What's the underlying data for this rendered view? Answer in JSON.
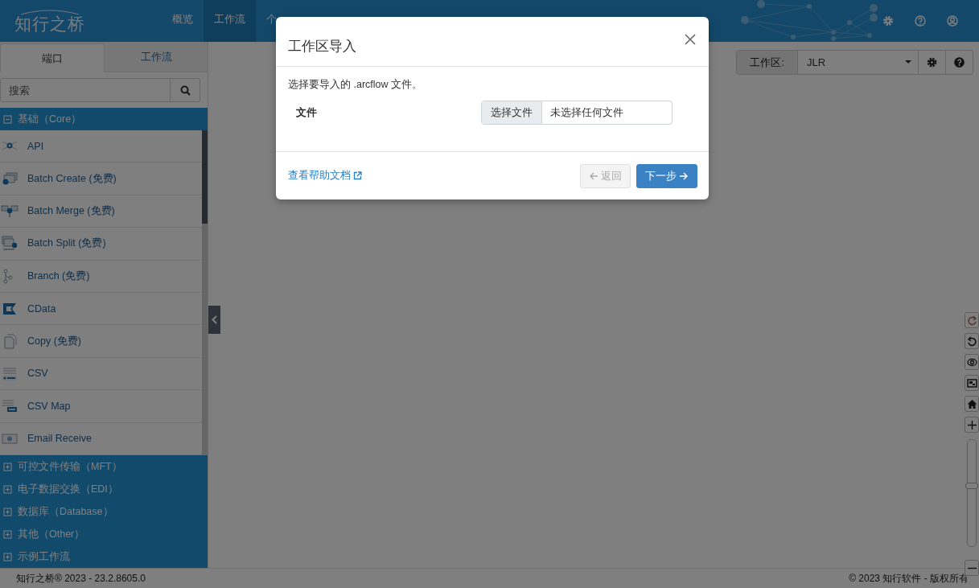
{
  "header": {
    "logo": "知行之桥",
    "nav": [
      {
        "label": "概览",
        "selected": false
      },
      {
        "label": "工作流",
        "selected": true
      },
      {
        "label": "个",
        "selected": false
      }
    ]
  },
  "sidebar": {
    "tabs": [
      {
        "label": "端口",
        "selected": true
      },
      {
        "label": "工作流",
        "selected": false
      }
    ],
    "search": {
      "placeholder": "搜索"
    },
    "categories": [
      {
        "label": "基础（Core）",
        "expanded": true,
        "items": [
          {
            "label": "API"
          },
          {
            "label": "Batch Create (免费)"
          },
          {
            "label": "Batch Merge (免费)"
          },
          {
            "label": "Batch Split (免费)"
          },
          {
            "label": "Branch (免费)"
          },
          {
            "label": "CData"
          },
          {
            "label": "Copy (免费)"
          },
          {
            "label": "CSV"
          },
          {
            "label": "CSV Map"
          },
          {
            "label": "Email Receive"
          }
        ]
      },
      {
        "label": "可控文件传输（MFT）",
        "expanded": false
      },
      {
        "label": "电子数据交换（EDI）",
        "expanded": false
      },
      {
        "label": "数据库（Database）",
        "expanded": false
      },
      {
        "label": "其他（Other）",
        "expanded": false
      },
      {
        "label": "示例工作流",
        "expanded": false
      }
    ]
  },
  "workspace": {
    "label": "工作区:",
    "value": "JLR"
  },
  "zoom": {
    "level": 0.56
  },
  "footer": {
    "left": "知行之桥® 2023 - 23.2.8605.0",
    "right": "© 2023 知行软件 - 版权所有"
  },
  "dialog": {
    "title": "工作区导入",
    "description": "选择要导入的 .arcflow 文件。",
    "field_label": "文件",
    "choose_button": "选择文件",
    "file_status": "未选择任何文件",
    "help_link": "查看帮助文档",
    "buttons": [
      {
        "kind": "back",
        "label": "返回",
        "disabled": true
      },
      {
        "kind": "next",
        "label": "下一步",
        "disabled": false
      }
    ]
  }
}
